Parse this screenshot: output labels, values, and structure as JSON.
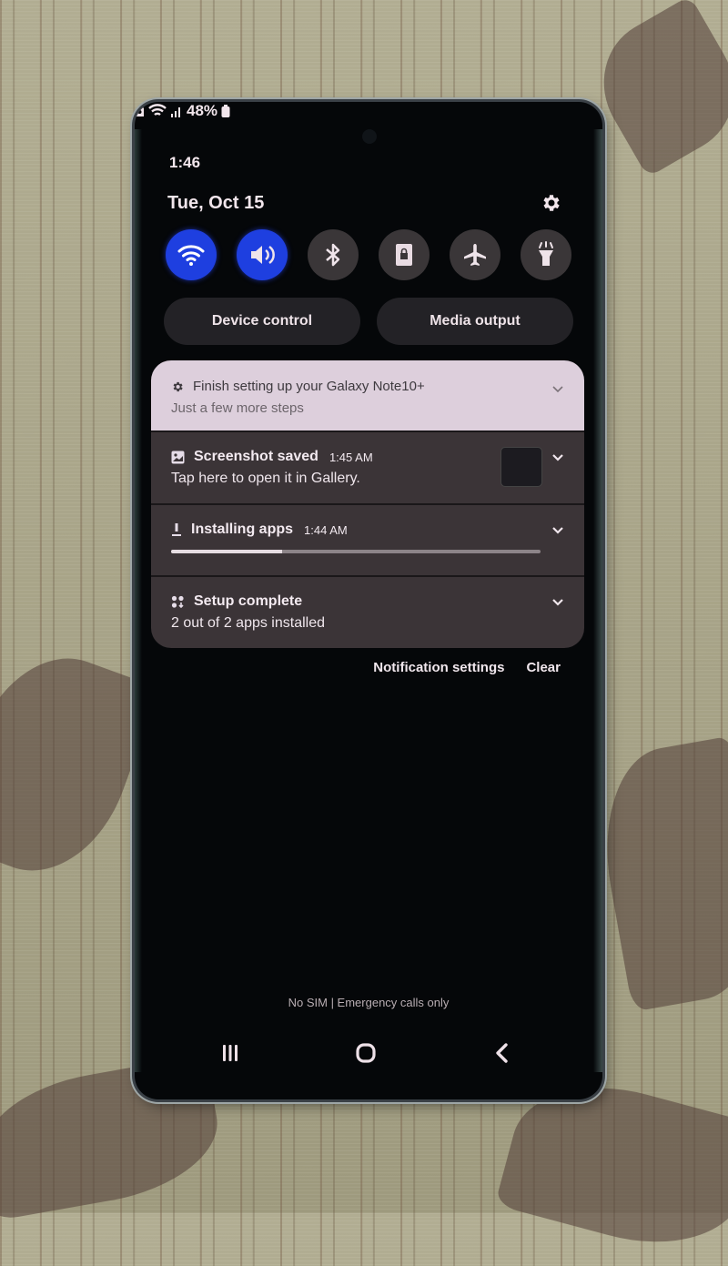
{
  "status_bar": {
    "time": "1:46",
    "battery_percent": "48%",
    "icons": [
      "sim-icon",
      "wifi-icon",
      "signal-icon",
      "battery-icon"
    ]
  },
  "header": {
    "date": "Tue, Oct 15",
    "settings_icon": "gear-icon"
  },
  "quick_settings": [
    {
      "name": "wifi",
      "icon": "wifi-icon",
      "active": true
    },
    {
      "name": "sound",
      "icon": "speaker-icon",
      "active": true
    },
    {
      "name": "bluetooth",
      "icon": "bluetooth-icon",
      "active": false
    },
    {
      "name": "screen-lock",
      "icon": "lock-icon",
      "active": false
    },
    {
      "name": "airplane-mode",
      "icon": "airplane-icon",
      "active": false
    },
    {
      "name": "flashlight",
      "icon": "flashlight-icon",
      "active": false
    }
  ],
  "quick_buttons": {
    "device_control": "Device control",
    "media_output": "Media output"
  },
  "notifications": [
    {
      "icon": "gear-icon",
      "title": "Finish setting up your Galaxy Note10+",
      "body": "Just a few more steps"
    },
    {
      "icon": "image-icon",
      "title": "Screenshot saved",
      "time": "1:45 AM",
      "body": "Tap here to open it in Gallery."
    },
    {
      "icon": "download-icon",
      "title": "Installing apps",
      "time": "1:44 AM",
      "progress": 0.3
    },
    {
      "icon": "apps-icon",
      "title": "Setup complete",
      "body": "2 out of 2 apps installed"
    }
  ],
  "footer": {
    "notification_settings": "Notification settings",
    "clear": "Clear",
    "carrier_status": "No SIM | Emergency calls only"
  },
  "colors": {
    "accent_active": "#1e3fe0",
    "panel_background": "#050709",
    "notification_light": "#ddcfdc",
    "notification_dark": "#3b3437"
  }
}
